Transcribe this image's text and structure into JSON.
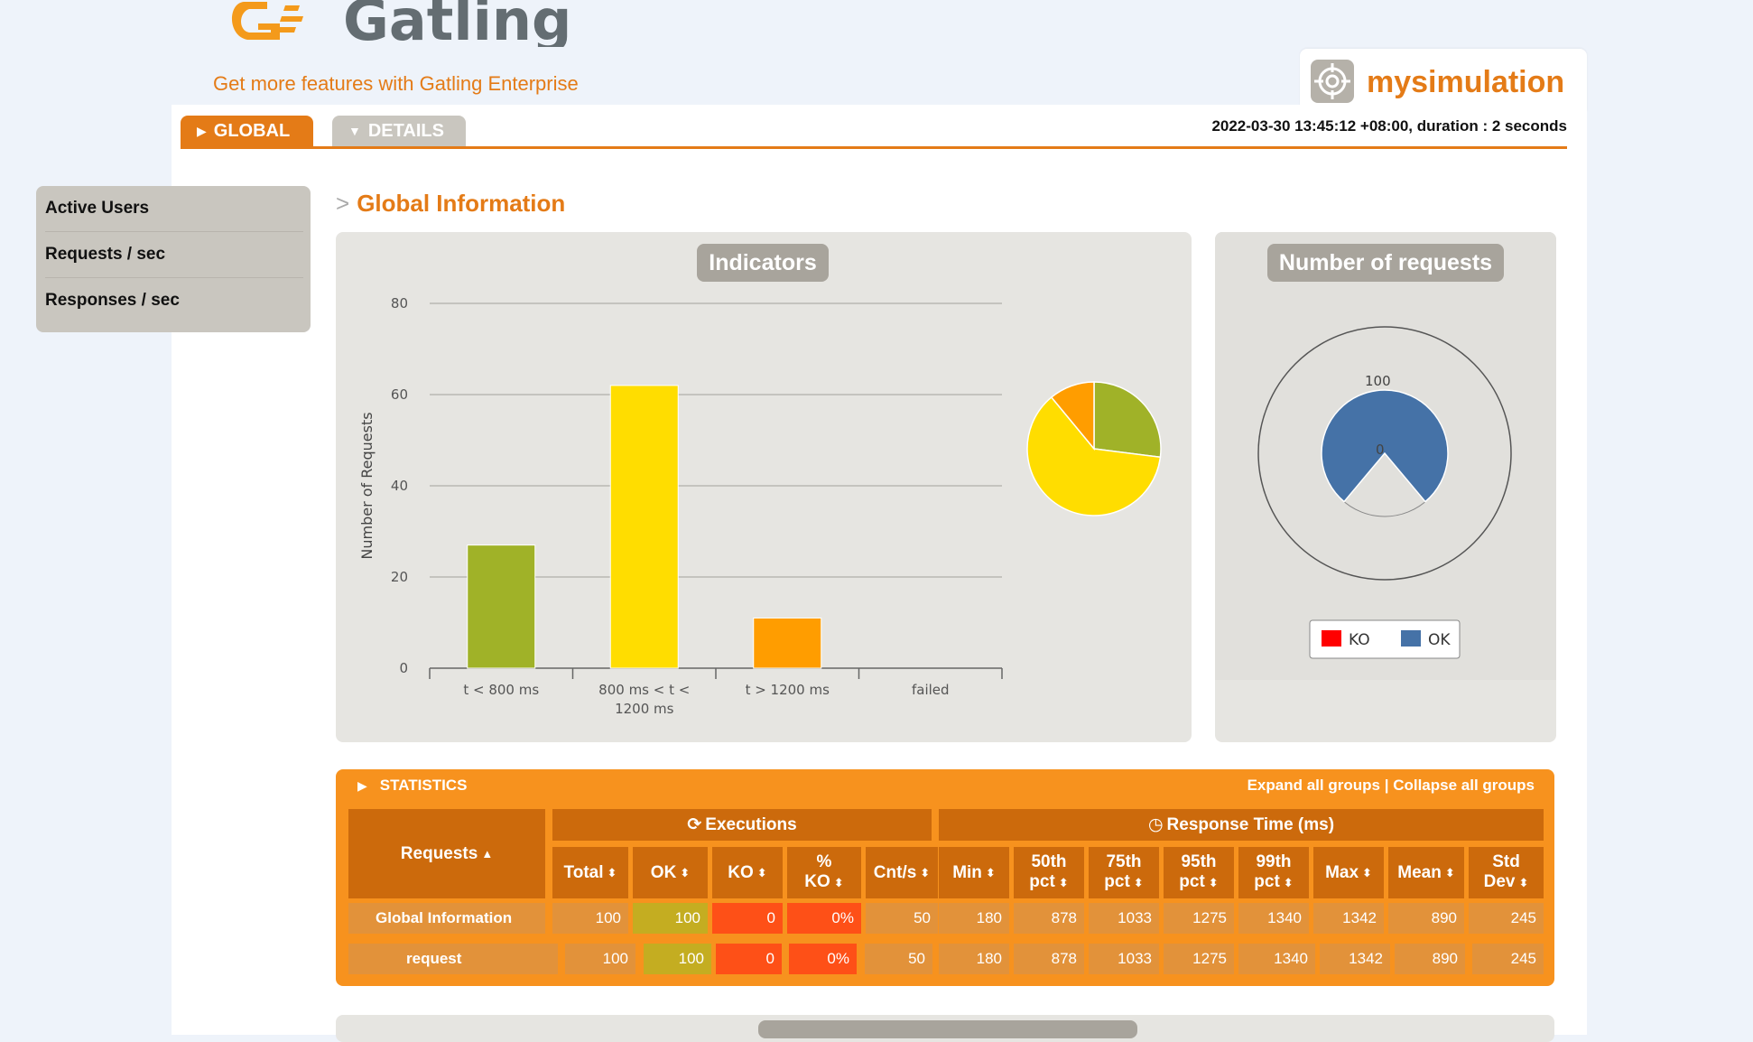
{
  "header": {
    "brand": "Gatling",
    "enterprise_link": "Get more features with Gatling Enterprise",
    "simulation_name": "mysimulation",
    "run_info": "2022-03-30 13:45:12 +08:00, duration : 2 seconds"
  },
  "tabs": [
    {
      "label": "GLOBAL",
      "active": true
    },
    {
      "label": "DETAILS",
      "active": false
    }
  ],
  "sidebar": {
    "items": [
      {
        "label": "Active Users"
      },
      {
        "label": "Requests / sec"
      },
      {
        "label": "Responses / sec"
      }
    ]
  },
  "section_title": "Global Information",
  "indicators": {
    "title": "Indicators"
  },
  "requests_panel": {
    "title": "Number of requests"
  },
  "chart_data": [
    {
      "type": "bar",
      "title": "Indicators",
      "ylabel": "Number of Requests",
      "ylim": [
        0,
        80
      ],
      "yticks": [
        "0",
        "20",
        "40",
        "60",
        "80"
      ],
      "categories": [
        "t < 800 ms",
        "800 ms < t < 1200 ms",
        "t > 1200 ms",
        "failed"
      ],
      "category_lines": [
        [
          "t < 800 ms"
        ],
        [
          "800 ms < t <",
          "1200 ms"
        ],
        [
          "t > 1200 ms"
        ],
        [
          "failed"
        ]
      ],
      "values": [
        27,
        62,
        11,
        0
      ],
      "colors": [
        "#a0b228",
        "#ffdd00",
        "#ff9d00",
        "#f15b4f"
      ],
      "grid": true
    },
    {
      "type": "pie",
      "categories": [
        "t < 800 ms",
        "800 ms < t < 1200 ms",
        "t > 1200 ms",
        "failed"
      ],
      "values": [
        27,
        62,
        11,
        0
      ],
      "colors": [
        "#a0b228",
        "#ffdd00",
        "#ff9d00",
        "#f15b4f"
      ]
    },
    {
      "type": "pie",
      "title": "Number of requests",
      "categories": [
        "KO",
        "OK"
      ],
      "values": [
        0,
        100
      ],
      "colors": [
        "#ff0000",
        "#4572a7"
      ],
      "labels": [
        "0",
        "100"
      ],
      "legend": "bottom"
    }
  ],
  "statistics": {
    "title": "STATISTICS",
    "expand_all": "Expand all groups",
    "separator": "|",
    "collapse_all": "Collapse all groups",
    "groups": {
      "executions": "Executions",
      "response_time": "Response Time (ms)"
    },
    "columns": {
      "requests": "Requests",
      "total": "Total",
      "ok": "OK",
      "ko": "KO",
      "pct_ko_1": "%",
      "pct_ko_2": "KO",
      "cnt": "Cnt/s",
      "min": "Min",
      "p50_1": "50th",
      "p50_2": "pct",
      "p75_1": "75th",
      "p75_2": "pct",
      "p95_1": "95th",
      "p95_2": "pct",
      "p99_1": "99th",
      "p99_2": "pct",
      "max": "Max",
      "mean": "Mean",
      "std_1": "Std",
      "std_2": "Dev"
    },
    "rows": [
      {
        "name": "Global Information",
        "total": "100",
        "ok": "100",
        "ko": "0",
        "pct_ko": "0%",
        "cnt": "50",
        "min": "180",
        "p50": "878",
        "p75": "1033",
        "p95": "1275",
        "p99": "1340",
        "max": "1342",
        "mean": "890",
        "std": "245"
      },
      {
        "name": "request",
        "total": "100",
        "ok": "100",
        "ko": "0",
        "pct_ko": "0%",
        "cnt": "50",
        "min": "180",
        "p50": "878",
        "p75": "1033",
        "p95": "1275",
        "p99": "1340",
        "max": "1342",
        "mean": "890",
        "std": "245"
      }
    ]
  },
  "colors": {
    "accent": "#e47b17",
    "stats_bg": "#f7921e",
    "header_cell": "#cc6a0c"
  }
}
